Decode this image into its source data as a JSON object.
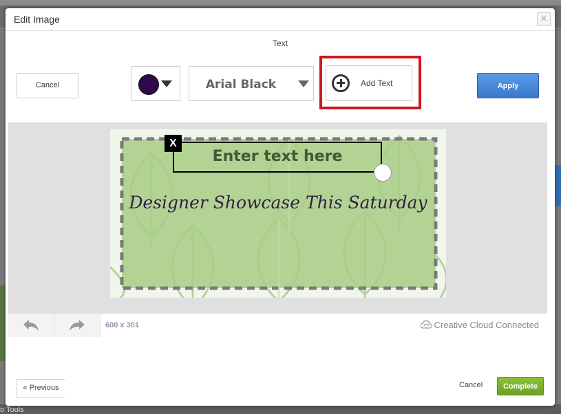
{
  "dialog": {
    "title": "Edit Image",
    "close_label": "✕"
  },
  "editor": {
    "mode_label": "Text",
    "cancel_label": "Cancel",
    "color": "#2f0a4a",
    "font": "Arial Black",
    "add_text_label": "Add Text",
    "apply_label": "Apply"
  },
  "canvas": {
    "text_box_value": "Enter text here",
    "remove_label": "X",
    "image_caption": "Designer Showcase This Saturday",
    "dimensions": "600 x 301",
    "cc_status": "Creative Cloud Connected"
  },
  "footer": {
    "previous_label": "« Previous",
    "cancel_label": "Cancel",
    "complete_label": "Complete"
  },
  "background": {
    "bottom_text": "o Tools"
  }
}
